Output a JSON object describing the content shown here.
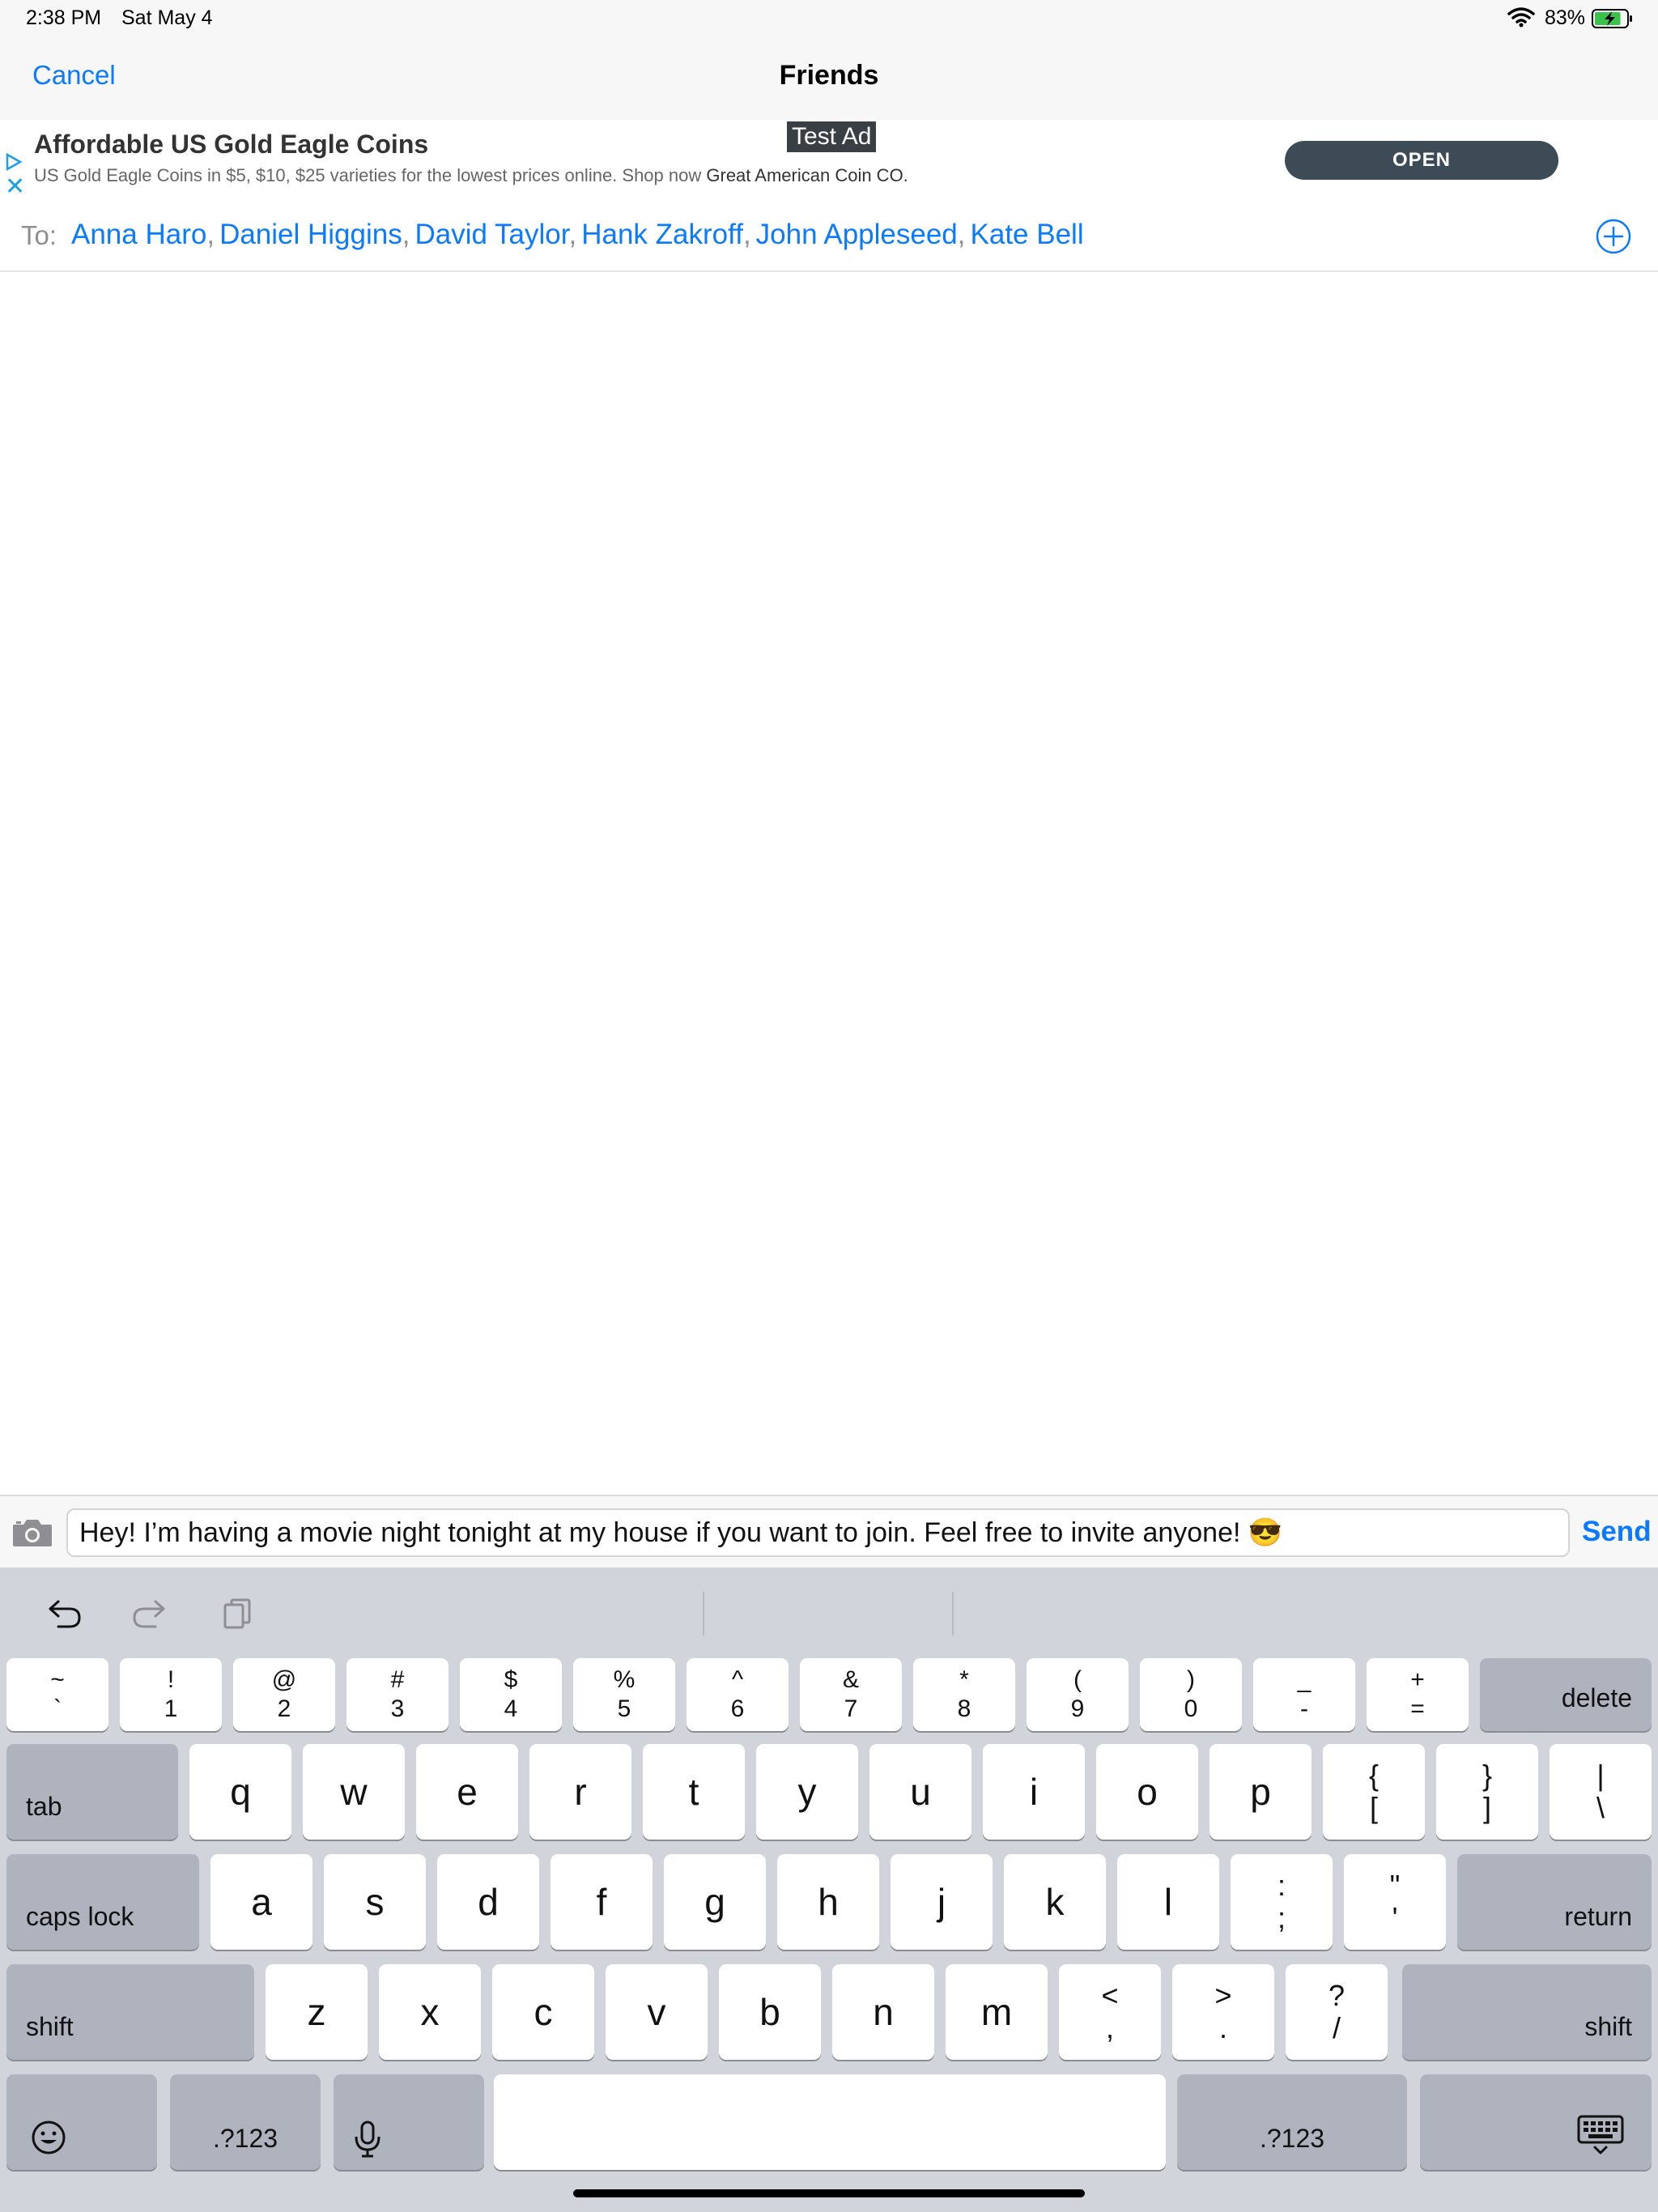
{
  "status_bar": {
    "time": "2:38 PM",
    "date": "Sat May 4",
    "battery_percent": "83%",
    "battery_level": 0.83,
    "charging": true
  },
  "nav": {
    "cancel_label": "Cancel",
    "title": "Friends"
  },
  "ad": {
    "title": "Affordable US Gold Eagle Coins",
    "description": "US Gold Eagle Coins in $5, $10, $25 varieties for the lowest prices online. Shop now",
    "advertiser": "Great American Coin CO.",
    "badge": "Test Ad",
    "cta": "OPEN",
    "icons": [
      "adchoices-play-icon",
      "close-icon"
    ]
  },
  "recipients": {
    "to_label": "To:",
    "names": [
      "Anna Haro",
      "Daniel Higgins",
      "David Taylor",
      "Hank Zakroff",
      "John Appleseed",
      "Kate Bell"
    ],
    "separator": ",",
    "add_icon": "plus-circle-icon"
  },
  "compose": {
    "camera_icon": "camera-icon",
    "message": "Hey! I’m having a movie night tonight at my house if you want to join. Feel free to invite anyone! 😎",
    "send_label": "Send"
  },
  "keyboard": {
    "toolbar_icons": [
      "undo-icon",
      "redo-icon",
      "paste-icon"
    ],
    "row1": [
      {
        "top": "~",
        "bottom": "`"
      },
      {
        "top": "!",
        "bottom": "1"
      },
      {
        "top": "@",
        "bottom": "2"
      },
      {
        "top": "#",
        "bottom": "3"
      },
      {
        "top": "$",
        "bottom": "4"
      },
      {
        "top": "%",
        "bottom": "5"
      },
      {
        "top": "^",
        "bottom": "6"
      },
      {
        "top": "&",
        "bottom": "7"
      },
      {
        "top": "*",
        "bottom": "8"
      },
      {
        "top": "(",
        "bottom": "9"
      },
      {
        "top": ")",
        "bottom": "0"
      },
      {
        "top": "_",
        "bottom": "-"
      },
      {
        "top": "+",
        "bottom": "="
      }
    ],
    "delete_label": "delete",
    "tab_label": "tab",
    "row2": [
      "q",
      "w",
      "e",
      "r",
      "t",
      "y",
      "u",
      "i",
      "o",
      "p"
    ],
    "row2_symbols": [
      {
        "top": "{",
        "bottom": "["
      },
      {
        "top": "}",
        "bottom": "]"
      },
      {
        "top": "|",
        "bottom": "\\"
      }
    ],
    "caps_label": "caps lock",
    "row3": [
      "a",
      "s",
      "d",
      "f",
      "g",
      "h",
      "j",
      "k",
      "l"
    ],
    "row3_symbols": [
      {
        "top": ":",
        "bottom": ";"
      },
      {
        "top": "\"",
        "bottom": "'"
      }
    ],
    "return_label": "return",
    "shift_label": "shift",
    "row4": [
      "z",
      "x",
      "c",
      "v",
      "b",
      "n",
      "m"
    ],
    "row4_symbols": [
      {
        "top": "<",
        "bottom": ","
      },
      {
        "top": ">",
        "bottom": "."
      },
      {
        "top": "?",
        "bottom": "/"
      }
    ],
    "numbers_label": ".?123",
    "emoji_icon": "emoji-icon",
    "mic_icon": "microphone-icon",
    "dismiss_icon": "keyboard-dismiss-icon"
  }
}
